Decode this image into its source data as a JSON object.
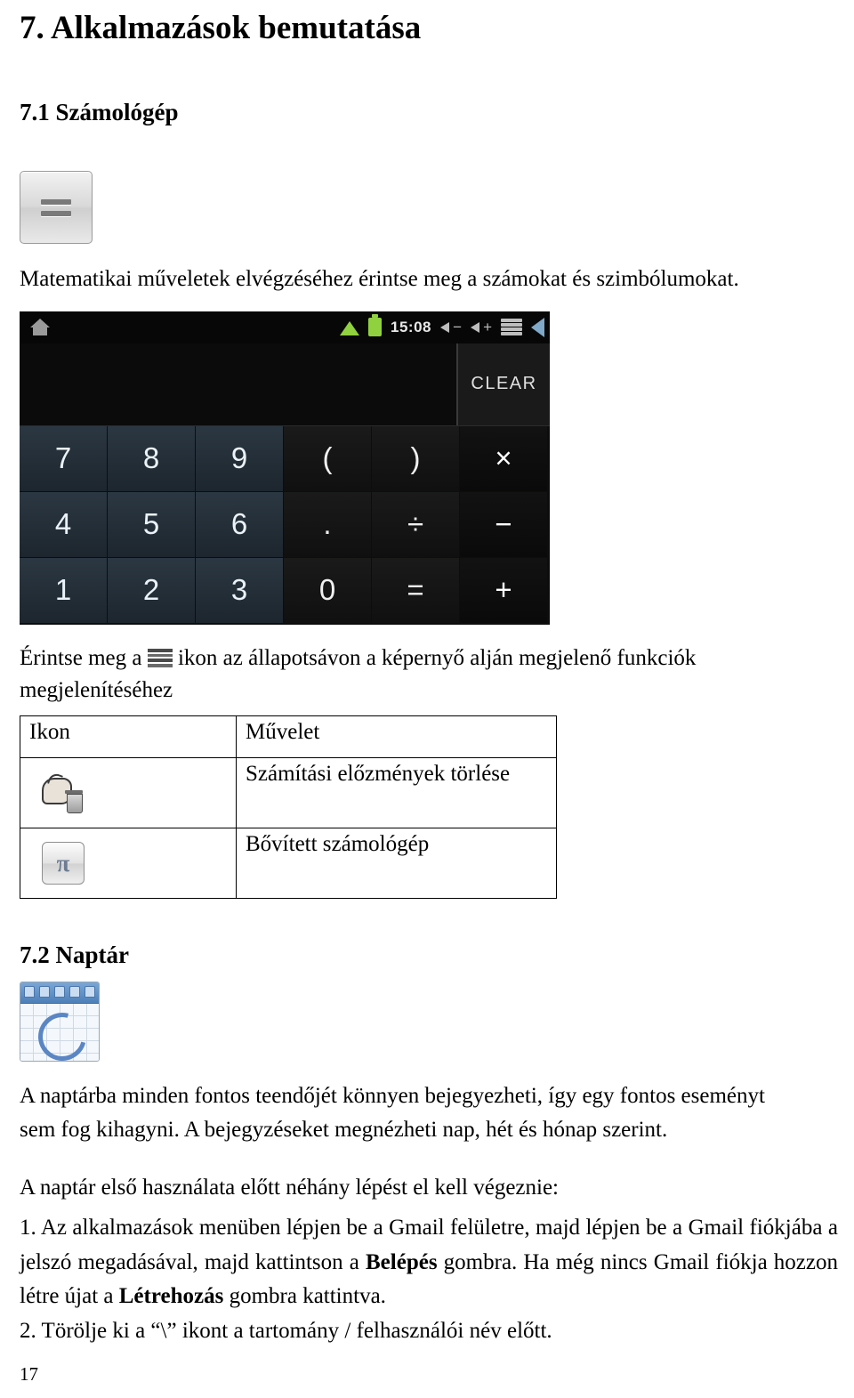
{
  "document": {
    "chapter_title": "7. Alkalmazások bemutatása",
    "section_1_title": "7.1 Számológép",
    "calc_intro": "Matematikai műveletek elvégzéséhez érintse meg a számokat és szimbólumokat.",
    "screenshot": {
      "status_bar": {
        "home_icon": "home-icon",
        "wifi_icon": "wifi-icon",
        "battery_icon": "battery-icon",
        "clock": "15:08",
        "volume_down_icon": "volume-down-icon",
        "volume_up_icon": "volume-up-icon",
        "menu_icon": "menu-icon",
        "back_icon": "back-icon"
      },
      "display": {
        "value": "",
        "clear_label": "CLEAR"
      },
      "keys": [
        "7",
        "8",
        "9",
        "(",
        ")",
        "×",
        "4",
        "5",
        "6",
        ".",
        "÷",
        "−",
        "1",
        "2",
        "3",
        "0",
        "=",
        "+"
      ]
    },
    "menu_instruction_part1": "Érintse meg a",
    "menu_instruction_part2": "ikon az állapotsávon a képernyő alján megjelenő funkciók",
    "menu_instruction_part3": "megjelenítéséhez",
    "table": {
      "headers": [
        "Ikon",
        "Művelet"
      ],
      "rows": [
        {
          "icon": "clear-history-icon",
          "action": "Számítási előzmények törlése"
        },
        {
          "icon": "pi-advanced-panel-icon",
          "action": "Bővített számológép"
        }
      ]
    },
    "section_2_title": "7.2 Naptár",
    "calendar_icon": "calendar-app-icon",
    "calendar_p1_line1": "A naptárba minden fontos teendőjét könnyen bejegyezheti, így egy fontos eseményt",
    "calendar_p1_line2": "sem fog kihagyni. A bejegyzéseket megnézheti nap, hét és hónap szerint.",
    "calendar_p2": "A naptár első használata előtt néhány lépést el kell végeznie:",
    "step1_a": "1. Az alkalmazások menüben lépjen be a Gmail felületre, majd lépjen be a Gmail fiókjába a jelszó megadásával, majd kattintson a ",
    "step1_bold1": "Belépés",
    "step1_b": " gombra. Ha még nincs Gmail fiókja hozzon létre újat a ",
    "step1_bold2": "Létrehozás",
    "step1_c": " gombra kattintva.",
    "step2": "2. Törölje ki a “\\” ikont a tartomány / felhasználói név előtt.",
    "page_number": "17"
  }
}
